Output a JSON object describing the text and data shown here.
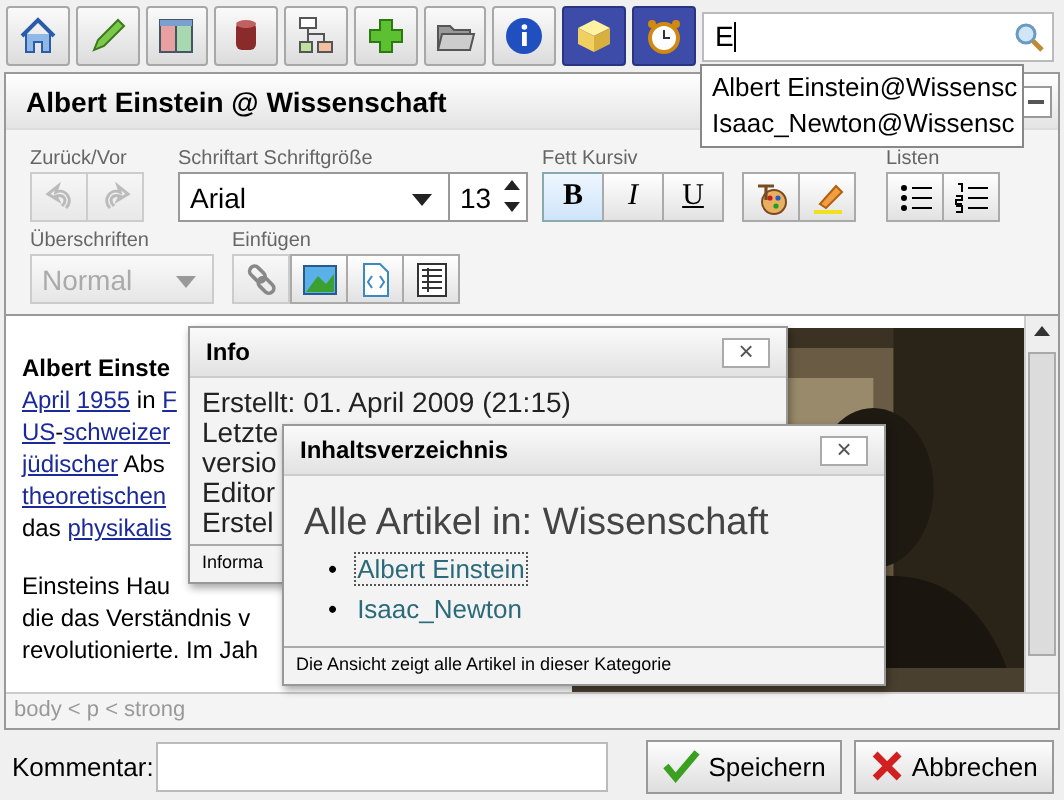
{
  "toolbar": [
    {
      "active": false
    },
    {
      "active": false
    },
    {
      "active": false
    },
    {
      "active": false
    },
    {
      "active": false
    },
    {
      "active": false
    },
    {
      "active": false
    },
    {
      "active": false
    },
    {
      "active": true
    },
    {
      "active": true
    }
  ],
  "search": {
    "value": "E",
    "suggestions": [
      "Albert Einstein@Wissensc",
      "Isaac_Newton@Wissensc"
    ]
  },
  "editor": {
    "title": "Albert Einstein @ Wissenschaft",
    "groups": {
      "history": "Zurück/Vor",
      "font": "Schriftart Schriftgröße",
      "format": "Fett Kursiv",
      "lists": "Listen",
      "headings": "Überschriften",
      "insert": "Einfügen"
    },
    "undo_disabled": true,
    "redo_disabled": true,
    "font": "Arial",
    "size": "13",
    "format_buttons": [
      {
        "label": "B",
        "selected": true
      },
      {
        "label": "I",
        "selected": false
      },
      {
        "label": "U",
        "selected": false
      }
    ],
    "heading": {
      "value": "Normal",
      "disabled": true
    },
    "paragraphs": [
      [
        [
          {
            "text": "Albert Einste",
            "bold": true
          }
        ],
        [
          {
            "text": "April",
            "link": true
          },
          {
            "text": "1955",
            "link": true,
            "space_before": true
          },
          {
            "text": " in "
          },
          {
            "text": "F",
            "link": true
          }
        ],
        [
          {
            "text": "US",
            "link": true
          },
          {
            "text": "-"
          },
          {
            "text": "schweizer",
            "link": true
          }
        ],
        [
          {
            "text": "jüdischer",
            "link": true
          },
          {
            "text": " Abs"
          }
        ],
        [
          {
            "text": "theoretischen",
            "link": true
          }
        ],
        [
          {
            "text": "das "
          },
          {
            "text": "physikalis",
            "link": true
          }
        ]
      ],
      [
        [
          {
            "text": "Einsteins Hau"
          }
        ],
        [
          {
            "text": "die das Verständnis v"
          }
        ],
        [
          {
            "text": "revolutionierte. Im Jah"
          }
        ]
      ]
    ],
    "path": "body < p < strong"
  },
  "comment": {
    "label": "Kommentar:"
  },
  "buttons": [
    {
      "kind": "save",
      "label": "Speichern"
    },
    {
      "kind": "cancel",
      "label": "Abbrechen"
    }
  ],
  "info_dialog": {
    "title": "Info",
    "close": "×",
    "lines": [
      "Erstellt: 01. April 2009 (21:15)",
      "Letzte",
      "versio",
      "Editor",
      "Erstel"
    ],
    "footer": "Informa"
  },
  "toc_dialog": {
    "title": "Inhaltsverzeichnis",
    "close": "×",
    "heading": "Alle Artikel in: Wissenschaft",
    "items": [
      {
        "marker": "•",
        "label": "Albert Einstein",
        "selected": true
      },
      {
        "marker": "•",
        "label": "Isaac_Newton",
        "selected": false
      }
    ],
    "footer": "Die Ansicht zeigt alle Artikel in dieser Kategorie"
  }
}
